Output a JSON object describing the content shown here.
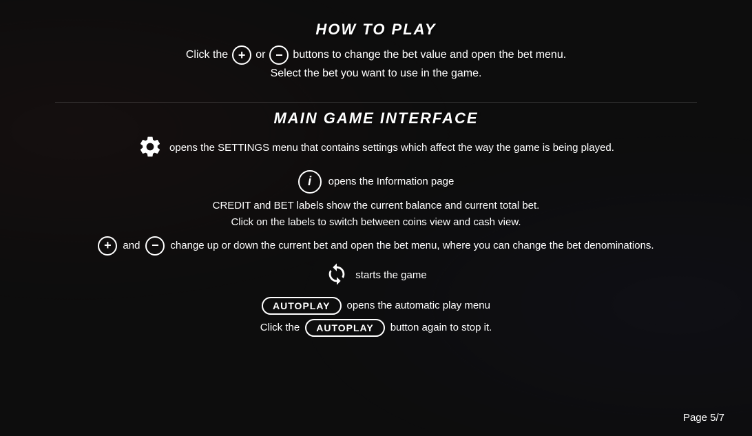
{
  "page": {
    "background_color": "#0d0d0d"
  },
  "how_to_play": {
    "title": "HOW TO PLAY",
    "line1_before": "Click the",
    "line1_or": "or",
    "line1_after": "buttons to change the bet value and open the bet menu.",
    "line2": "Select the bet you want to use in the game.",
    "plus_symbol": "+",
    "minus_symbol": "−"
  },
  "main_game": {
    "title": "MAIN GAME INTERFACE",
    "settings_text": "opens the SETTINGS menu that contains settings which affect the way the game is being played.",
    "info_text": "opens the Information page",
    "credit_bet_line1": "CREDIT and BET labels show the current balance and current total bet.",
    "credit_bet_line2": "Click on the labels to switch between coins view and cash view.",
    "plus_minus_text": "change up or down the current bet and open the bet menu, where you can change the bet denominations.",
    "and_text": "and",
    "spin_text": "starts the game",
    "autoplay_label": "AUTOPLAY",
    "autoplay_text": "opens the automatic play menu",
    "stop_line_before": "Click the",
    "stop_line_label": "AUTOPLAY",
    "stop_line_after": "button again to stop it.",
    "plus_symbol": "+",
    "minus_symbol": "−"
  },
  "footer": {
    "page_indicator": "Page 5/7"
  }
}
